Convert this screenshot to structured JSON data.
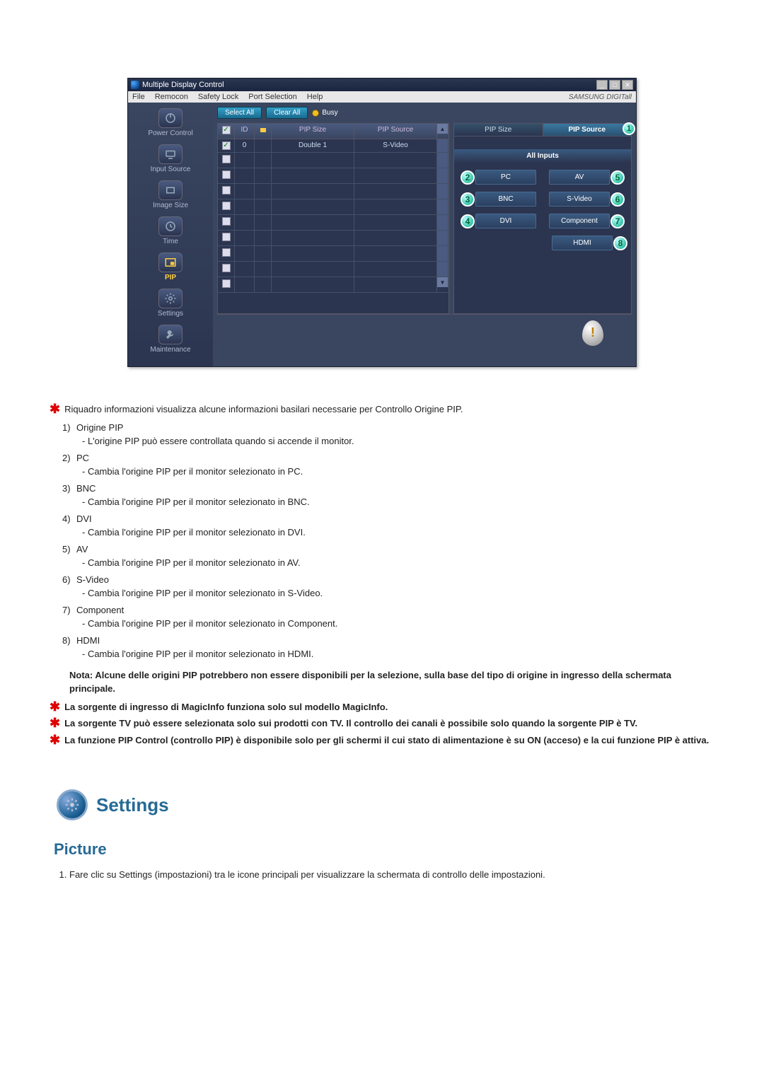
{
  "window": {
    "title": "Multiple Display Control",
    "brand": "SAMSUNG DIGITall"
  },
  "menubar": {
    "file": "File",
    "remocon": "Remocon",
    "safety_lock": "Safety Lock",
    "port_selection": "Port Selection",
    "help": "Help"
  },
  "sidebar": {
    "power_control": "Power Control",
    "input_source": "Input Source",
    "image_size": "Image Size",
    "time": "Time",
    "pip": "PIP",
    "settings": "Settings",
    "maintenance": "Maintenance"
  },
  "toolbar": {
    "select_all": "Select All",
    "clear_all": "Clear All",
    "busy": "Busy"
  },
  "grid": {
    "headers": {
      "id": "ID",
      "pip_size": "PIP Size",
      "pip_source": "PIP Source"
    },
    "row0": {
      "id": "0",
      "pip_size": "Double 1",
      "pip_source": "S-Video"
    }
  },
  "right_panel": {
    "tab_size": "PIP Size",
    "tab_source": "PIP Source",
    "badge1": "1",
    "all_inputs": "All Inputs",
    "pc": "PC",
    "av": "AV",
    "bnc": "BNC",
    "svideo": "S-Video",
    "dvi": "DVI",
    "component": "Component",
    "hdmi": "HDMI",
    "n2": "2",
    "n3": "3",
    "n4": "4",
    "n5": "5",
    "n6": "6",
    "n7": "7",
    "n8": "8"
  },
  "doc": {
    "intro": "Riquadro informazioni visualizza alcune informazioni basilari necessarie per Controllo Origine PIP.",
    "items": {
      "i1t": "1)",
      "i1l": "Origine PIP",
      "i1d": "- L'origine PIP può essere controllata quando si accende il monitor.",
      "i2t": "2)",
      "i2l": "PC",
      "i2d": "- Cambia l'origine PIP per il monitor selezionato in PC.",
      "i3t": "3)",
      "i3l": "BNC",
      "i3d": "- Cambia l'origine PIP per il monitor selezionato in BNC.",
      "i4t": "4)",
      "i4l": "DVI",
      "i4d": "- Cambia l'origine PIP per il monitor selezionato in DVI.",
      "i5t": "5)",
      "i5l": "AV",
      "i5d": "- Cambia l'origine PIP per il monitor selezionato in AV.",
      "i6t": "6)",
      "i6l": "S-Video",
      "i6d": "- Cambia l'origine PIP per il monitor selezionato in S-Video.",
      "i7t": "7)",
      "i7l": "Component",
      "i7d": "- Cambia l'origine PIP per il monitor selezionato in Component.",
      "i8t": "8)",
      "i8l": "HDMI",
      "i8d": "- Cambia l'origine PIP per il monitor selezionato in HDMI."
    },
    "note": "Nota: Alcune delle origini PIP potrebbero non essere disponibili per la selezione, sulla base del tipo di origine in ingresso della schermata principale.",
    "star2": "La sorgente di ingresso di MagicInfo funziona solo sul modello MagicInfo.",
    "star3": "La sorgente TV può essere selezionata solo sui prodotti con TV. Il controllo dei canali è possibile solo quando la sorgente PIP è TV.",
    "star4": "La funzione PIP Control (controllo PIP) è disponibile solo per gli schermi il cui stato di alimentazione è su ON (acceso) e la cui funzione PIP è attiva."
  },
  "settings_section": {
    "title": "Settings",
    "picture": "Picture",
    "instr1": "Fare clic su Settings (impostazioni) tra le icone principali per visualizzare la schermata di controllo delle impostazioni."
  }
}
